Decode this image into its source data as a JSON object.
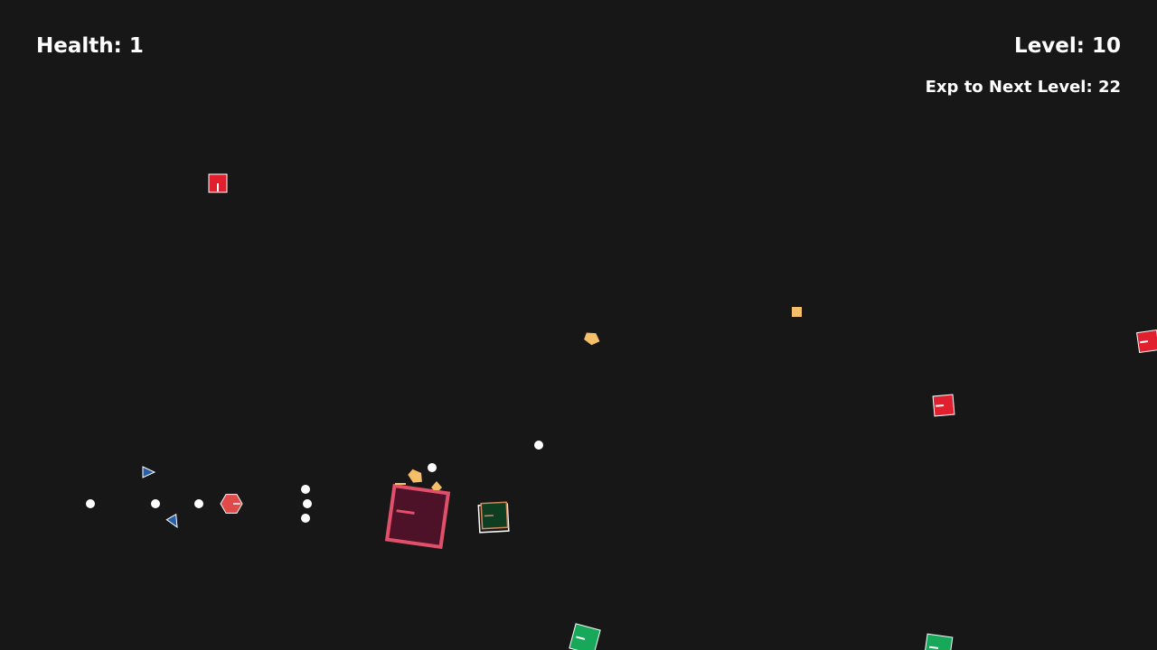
{
  "hud": {
    "health": "Health: 1",
    "level": "Level: 10",
    "exp_to_next": "Exp to Next Level: 22"
  },
  "colors": {
    "background": "#171717",
    "hud_text": "#ffffff",
    "enemy_red": "#e0202e",
    "enemy_green": "#17a85a",
    "boss_fill": "#4d1228",
    "boss_outline": "#e0506a",
    "player_fill": "#0f3d22",
    "exp_orb": "#f5bf6a",
    "bullet": "#ffffff",
    "drone_blue": "#2a5fa8",
    "hex_enemy": "#e04a4a"
  },
  "entities": {
    "player": "player-ship",
    "boss": "large-enemy",
    "enemies": [
      "red-square-enemy",
      "green-square-enemy",
      "hex-enemy",
      "triangle-drone"
    ],
    "pickups": [
      "exp-orb"
    ],
    "projectiles": [
      "bullet"
    ]
  }
}
